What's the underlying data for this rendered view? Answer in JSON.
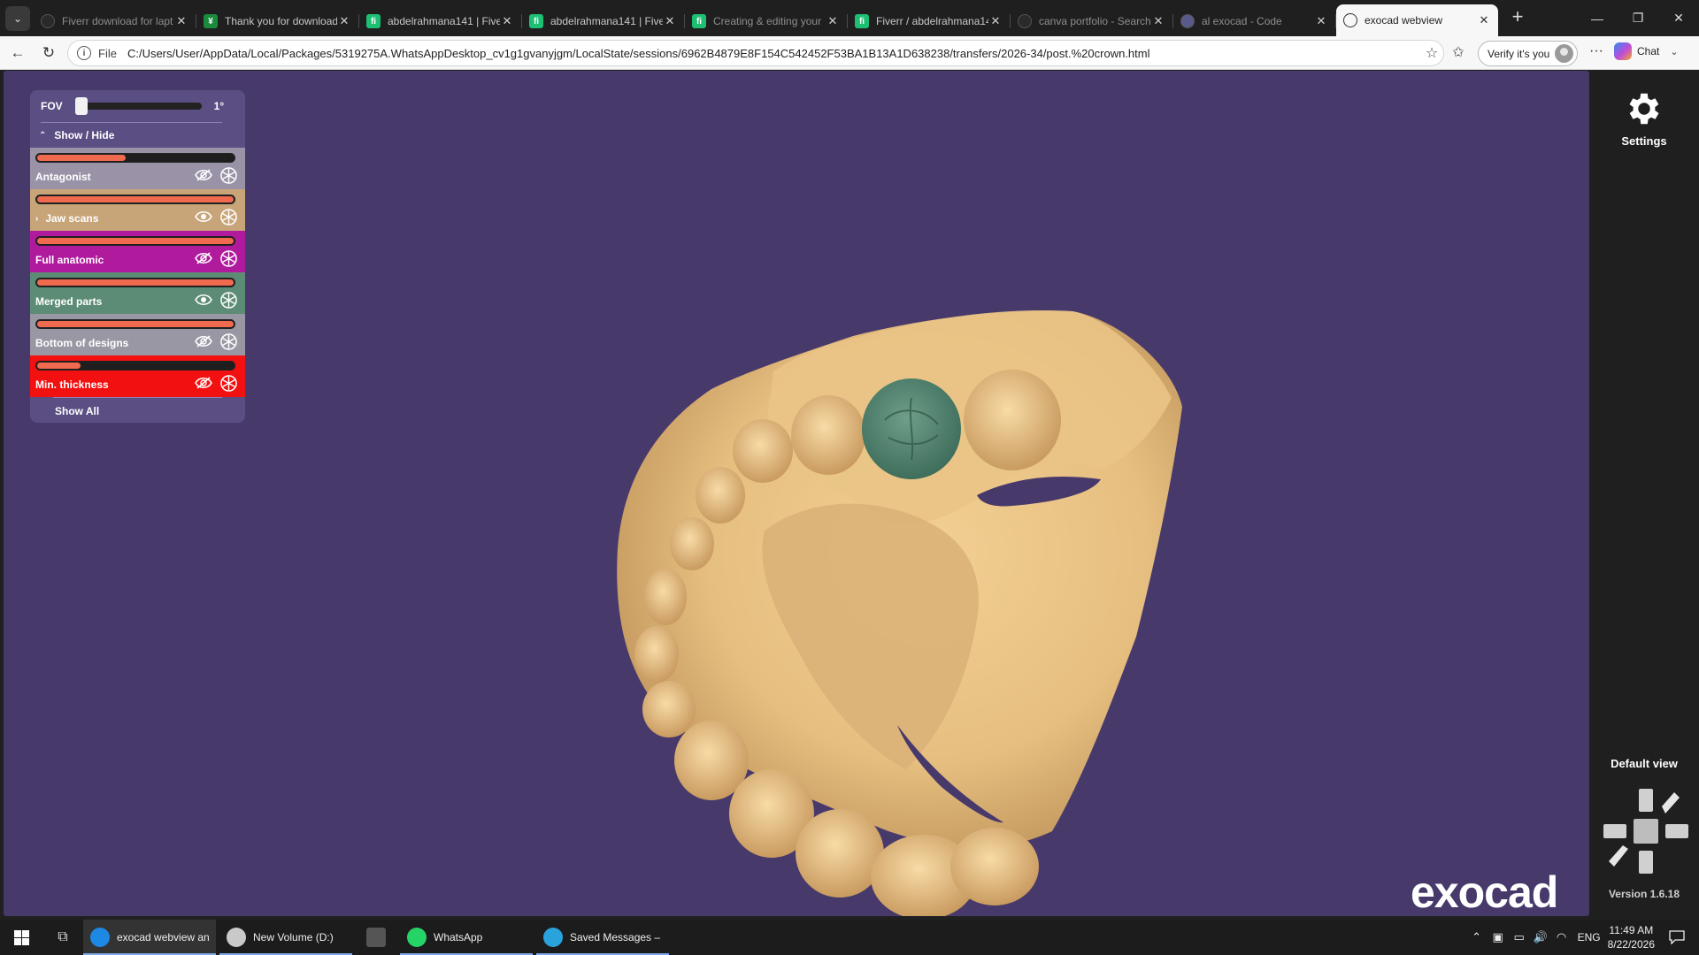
{
  "browser": {
    "tabs": [
      {
        "label": "Fiverr download for lapt",
        "favicon": "#2a2a2a",
        "favicon_char": "",
        "dim": true
      },
      {
        "label": "Thank you for download",
        "favicon": "#1a8a3c",
        "favicon_char": "¥",
        "dim": false
      },
      {
        "label": "abdelrahmana141 | Fiver",
        "favicon": "#1dbf73",
        "favicon_char": "fi",
        "dim": false
      },
      {
        "label": "abdelrahmana141 | Fiver",
        "favicon": "#1dbf73",
        "favicon_char": "fi",
        "dim": false
      },
      {
        "label": "Creating & editing your",
        "favicon": "#1dbf73",
        "favicon_char": "fi",
        "dim": true
      },
      {
        "label": "Fiverr / abdelrahmana14",
        "favicon": "#1dbf73",
        "favicon_char": "fi",
        "dim": false
      },
      {
        "label": "canva portfolio - Search",
        "favicon": "#2a2a2a",
        "favicon_char": "",
        "dim": true
      },
      {
        "label": "al exocad - Code",
        "favicon": "#5a5a8a",
        "favicon_char": "",
        "dim": true
      },
      {
        "label": "exocad webview",
        "favicon": "#ffffff",
        "favicon_char": "",
        "active": true
      }
    ],
    "url_prefix": "File",
    "url": "C:/Users/User/AppData/Local/Packages/5319275A.WhatsAppDesktop_cv1g1gvanyjgm/LocalState/sessions/6962B4879E8F154C542452F53BA1B13A1D638238/transfers/2026-34/post.%20crown.html",
    "verify_label": "Verify it's you",
    "chat_label": "Chat"
  },
  "panel": {
    "fov_label": "FOV",
    "fov_value": "1°",
    "fov_fraction": 0.0,
    "show_hide_label": "Show / Hide",
    "show_all_label": "Show All",
    "layers": [
      {
        "name": "Antagonist",
        "color": "#9a93a8",
        "opacity": 0.45,
        "visible": false,
        "expandable": false
      },
      {
        "name": "Jaw scans",
        "color": "#c8a479",
        "opacity": 1.0,
        "visible": true,
        "expandable": true
      },
      {
        "name": "Full anatomic",
        "color": "#b01a9c",
        "opacity": 1.0,
        "visible": false,
        "expandable": false
      },
      {
        "name": "Merged parts",
        "color": "#5c8c76",
        "opacity": 1.0,
        "visible": true,
        "expandable": false
      },
      {
        "name": "Bottom of designs",
        "color": "#9a97a4",
        "opacity": 1.0,
        "visible": false,
        "expandable": false
      },
      {
        "name": "Min. thickness",
        "color": "#f21010",
        "opacity": 0.22,
        "visible": false,
        "expandable": false
      }
    ]
  },
  "right_panel": {
    "settings_label": "Settings",
    "default_view_label": "Default view",
    "version": "Version 1.6.18",
    "logo": "exocad"
  },
  "taskbar": {
    "apps": [
      {
        "label": "exocad webview an...",
        "icon_color": "#1e88e5",
        "running": true,
        "active": true
      },
      {
        "label": "New Volume (D:)",
        "icon_color": "#c9c9c9",
        "running": true,
        "active": false
      },
      {
        "label": "",
        "icon_color": "#555555",
        "running": false,
        "active": false
      },
      {
        "label": "WhatsApp",
        "icon_color": "#25d366",
        "running": true,
        "active": false
      },
      {
        "label": "Saved Messages – (...",
        "icon_color": "#2aa3dc",
        "running": true,
        "active": false
      }
    ],
    "lang": "ENG",
    "time": "11:49 AM",
    "date": "8/22/2026"
  }
}
